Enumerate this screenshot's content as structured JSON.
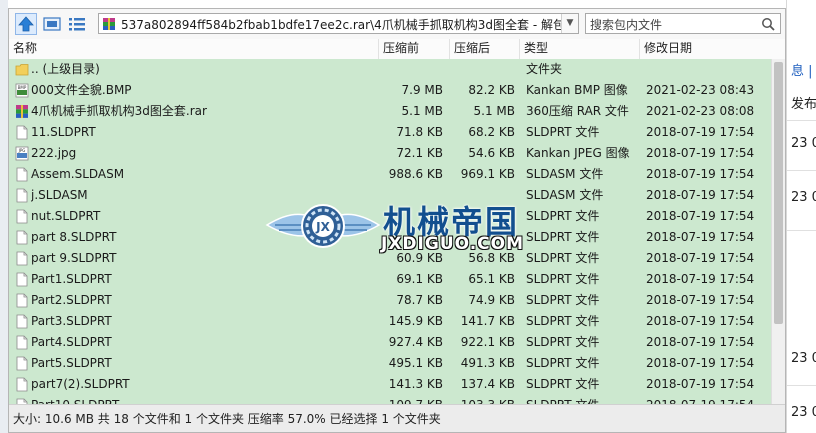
{
  "background": {
    "right_fragments": [
      "息 |",
      "发布日",
      "23 0",
      "23 0",
      "23 0",
      "23 0"
    ]
  },
  "toolbar": {
    "address": "537a802894ff584b2fbab1bdfe17ee2c.rar\\4爪机械手抓取机构3d图全套 - 解包大小为 10.6 MB",
    "search_placeholder": "搜索包内文件"
  },
  "columns": {
    "name": "名称",
    "size": "压缩前",
    "packed": "压缩后",
    "type": "类型",
    "date": "修改日期"
  },
  "files": [
    {
      "icon": "folder-icon",
      "name": ".. (上级目录)",
      "size": "",
      "packed": "",
      "type": "文件夹",
      "date": ""
    },
    {
      "icon": "bmp-image-icon",
      "name": "000文件全貌.BMP",
      "size": "7.9 MB",
      "packed": "82.2 KB",
      "type": "Kankan BMP 图像",
      "date": "2021-02-23 08:43"
    },
    {
      "icon": "rar-archive-icon",
      "name": "4爪机械手抓取机构3d图全套.rar",
      "size": "5.1 MB",
      "packed": "5.1 MB",
      "type": "360压缩 RAR 文件",
      "date": "2021-02-23 08:08"
    },
    {
      "icon": "document-icon",
      "name": "11.SLDPRT",
      "size": "71.8 KB",
      "packed": "68.2 KB",
      "type": "SLDPRT 文件",
      "date": "2018-07-19 17:54"
    },
    {
      "icon": "jpg-image-icon",
      "name": "222.jpg",
      "size": "72.1 KB",
      "packed": "54.6 KB",
      "type": "Kankan JPEG 图像",
      "date": "2018-07-19 17:54"
    },
    {
      "icon": "document-icon",
      "name": "Assem.SLDASM",
      "size": "988.6 KB",
      "packed": "969.1 KB",
      "type": "SLDASM 文件",
      "date": "2018-07-19 17:54"
    },
    {
      "icon": "document-icon",
      "name": "j.SLDASM",
      "size": "",
      "packed": "",
      "type": "SLDASM 文件",
      "date": "2018-07-19 17:54"
    },
    {
      "icon": "document-icon",
      "name": "nut.SLDPRT",
      "size": "",
      "packed": "",
      "type": "SLDPRT 文件",
      "date": "2018-07-19 17:54"
    },
    {
      "icon": "document-icon",
      "name": "part 8.SLDPRT",
      "size": "",
      "packed": "",
      "type": "SLDPRT 文件",
      "date": "2018-07-19 17:54"
    },
    {
      "icon": "document-icon",
      "name": "part 9.SLDPRT",
      "size": "60.9 KB",
      "packed": "56.8 KB",
      "type": "SLDPRT 文件",
      "date": "2018-07-19 17:54"
    },
    {
      "icon": "document-icon",
      "name": "Part1.SLDPRT",
      "size": "69.1 KB",
      "packed": "65.1 KB",
      "type": "SLDPRT 文件",
      "date": "2018-07-19 17:54"
    },
    {
      "icon": "document-icon",
      "name": "Part2.SLDPRT",
      "size": "78.7 KB",
      "packed": "74.9 KB",
      "type": "SLDPRT 文件",
      "date": "2018-07-19 17:54"
    },
    {
      "icon": "document-icon",
      "name": "Part3.SLDPRT",
      "size": "145.9 KB",
      "packed": "141.7 KB",
      "type": "SLDPRT 文件",
      "date": "2018-07-19 17:54"
    },
    {
      "icon": "document-icon",
      "name": "Part4.SLDPRT",
      "size": "927.4 KB",
      "packed": "922.1 KB",
      "type": "SLDPRT 文件",
      "date": "2018-07-19 17:54"
    },
    {
      "icon": "document-icon",
      "name": "Part5.SLDPRT",
      "size": "495.1 KB",
      "packed": "491.3 KB",
      "type": "SLDPRT 文件",
      "date": "2018-07-19 17:54"
    },
    {
      "icon": "document-icon",
      "name": "part7(2).SLDPRT",
      "size": "141.3 KB",
      "packed": "137.4 KB",
      "type": "SLDPRT 文件",
      "date": "2018-07-19 17:54"
    },
    {
      "icon": "document-icon",
      "name": "Part10.SLDPRT",
      "size": "109.7 KB",
      "packed": "103.3 KB",
      "type": "SLDPRT 文件",
      "date": "2018-07-19 17:54"
    }
  ],
  "status": "大小: 10.6 MB 共 18 个文件和 1 个文件夹 压缩率 57.0% 已经选择 1 个文件夹",
  "watermark": {
    "title": "机械帝国",
    "url": "JXDIGUO.COM",
    "emblem_letters": "JX"
  },
  "colors": {
    "list_background": "#cce8cf",
    "watermark_blue": "#124f8f"
  }
}
